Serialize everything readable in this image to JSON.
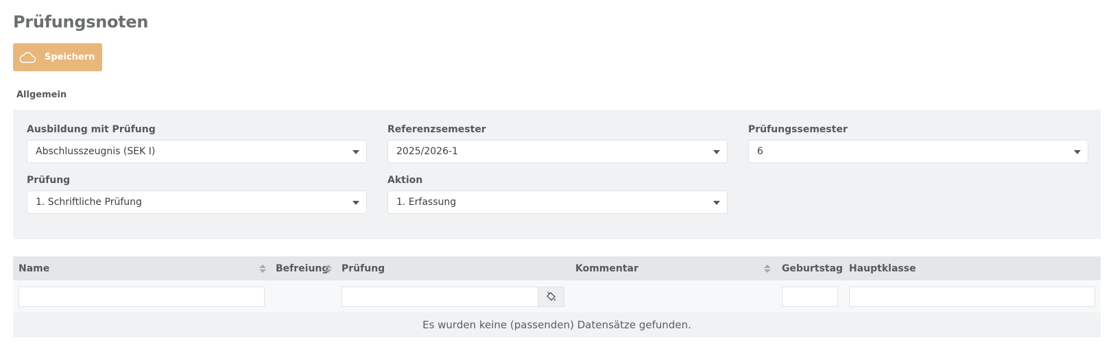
{
  "page": {
    "title": "Prüfungsnoten"
  },
  "toolbar": {
    "save_label": "Speichern",
    "save_icon": "cloud-icon",
    "accent": "#e9b77b"
  },
  "section": {
    "label": "Allgemein"
  },
  "filters": {
    "ausbildung": {
      "label": "Ausbildung mit Prüfung",
      "value": "Abschlusszeugnis (SEK I)"
    },
    "referenzsemester": {
      "label": "Referenzsemester",
      "value": "2025/2026-1"
    },
    "pruefungssemester": {
      "label": "Prüfungssemester",
      "value": "6"
    },
    "pruefung": {
      "label": "Prüfung",
      "value": "1. Schriftliche Prüfung"
    },
    "aktion": {
      "label": "Aktion",
      "value": "1. Erfassung"
    }
  },
  "table": {
    "columns": {
      "name": "Name",
      "befreiung": "Befreiung",
      "pruefung": "Prüfung",
      "kommentar": "Kommentar",
      "geburtstag": "Geburtstag",
      "hauptklasse": "Hauptklasse"
    },
    "empty_message": "Es wurden keine (passenden) Datensätze gefunden.",
    "fill_icon": "paint-bucket-icon"
  }
}
